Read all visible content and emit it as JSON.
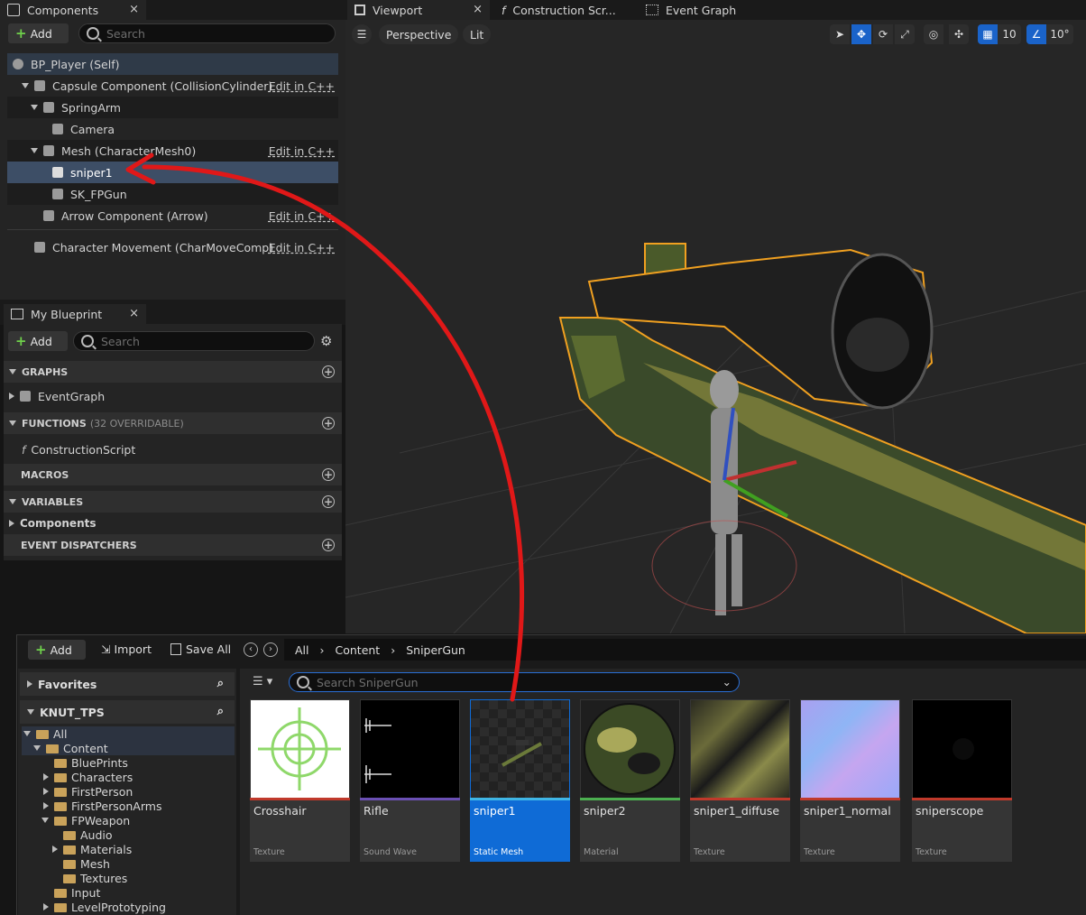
{
  "components_panel": {
    "tab": "Components",
    "add": "Add",
    "search_placeholder": "Search",
    "items": [
      {
        "label": "BP_Player (Self)"
      },
      {
        "label": "Capsule Component (CollisionCylinder)",
        "edit": "Edit in C++"
      },
      {
        "label": "SpringArm"
      },
      {
        "label": "Camera"
      },
      {
        "label": "Mesh (CharacterMesh0)",
        "edit": "Edit in C++"
      },
      {
        "label": "sniper1"
      },
      {
        "label": "SK_FPGun"
      },
      {
        "label": "Arrow Component (Arrow)",
        "edit": "Edit in C++"
      },
      {
        "label": "Character Movement (CharMoveComp)",
        "edit": "Edit in C++"
      }
    ]
  },
  "blueprint_panel": {
    "tab": "My Blueprint",
    "add": "Add",
    "search_placeholder": "Search",
    "graphs": "GRAPHS",
    "event_graph": "EventGraph",
    "functions": "FUNCTIONS",
    "functions_note": "(32 OVERRIDABLE)",
    "construction_script": "ConstructionScript",
    "macros": "MACROS",
    "variables": "VARIABLES",
    "components": "Components",
    "event_dispatchers": "EVENT DISPATCHERS"
  },
  "editor_tabs": {
    "viewport": "Viewport",
    "construction": "Construction Scr...",
    "event_graph": "Event Graph"
  },
  "viewport": {
    "perspective": "Perspective",
    "lit": "Lit",
    "grid_snap": "10",
    "rot_snap": "10°"
  },
  "content_browser": {
    "add": "Add",
    "import": "Import",
    "save_all": "Save All",
    "breadcrumb": [
      "All",
      "Content",
      "SniperGun"
    ],
    "search_placeholder": "Search SniperGun",
    "favorites": "Favorites",
    "project": "KNUT_TPS",
    "tree": [
      {
        "label": "All",
        "depth": 0,
        "open": true
      },
      {
        "label": "Content",
        "depth": 1,
        "open": true
      },
      {
        "label": "BluePrints",
        "depth": 2
      },
      {
        "label": "Characters",
        "depth": 2,
        "arrow": true
      },
      {
        "label": "FirstPerson",
        "depth": 2,
        "arrow": true
      },
      {
        "label": "FirstPersonArms",
        "depth": 2,
        "arrow": true
      },
      {
        "label": "FPWeapon",
        "depth": 2,
        "open": true
      },
      {
        "label": "Audio",
        "depth": 3
      },
      {
        "label": "Materials",
        "depth": 3,
        "arrow": true
      },
      {
        "label": "Mesh",
        "depth": 3
      },
      {
        "label": "Textures",
        "depth": 3
      },
      {
        "label": "Input",
        "depth": 2
      },
      {
        "label": "LevelPrototyping",
        "depth": 2,
        "arrow": true
      }
    ],
    "assets": [
      {
        "name": "Crosshair",
        "type": "Texture",
        "color": "#c0392b"
      },
      {
        "name": "Rifle",
        "type": "Sound Wave",
        "color": "#6a4fb3"
      },
      {
        "name": "sniper1",
        "type": "Static Mesh",
        "color": "#3fb6e6"
      },
      {
        "name": "sniper2",
        "type": "Material",
        "color": "#4caf50"
      },
      {
        "name": "sniper1_diffuse",
        "type": "Texture",
        "color": "#c0392b"
      },
      {
        "name": "sniper1_normal",
        "type": "Texture",
        "color": "#c0392b"
      },
      {
        "name": "sniperscope",
        "type": "Texture",
        "color": "#c0392b"
      }
    ]
  }
}
